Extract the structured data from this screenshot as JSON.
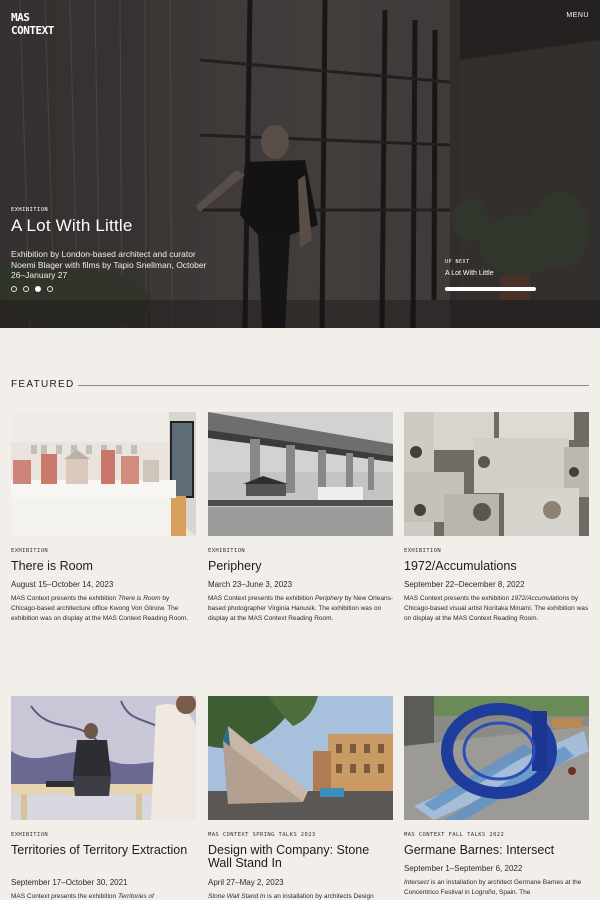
{
  "brand": {
    "logo_line1": "MAS",
    "logo_line2": "CONTEXT"
  },
  "nav": {
    "menu_label": "MENU"
  },
  "hero": {
    "eyebrow": "EXHIBITION",
    "title": "A Lot With Little",
    "description": "Exhibition by London-based architect and curator Noemi Blager with films by Tapio Snellman, October 26–January 27",
    "slides": 4,
    "active_slide": 3,
    "up_next_label": "UP NEXT",
    "up_next_title": "A Lot With Little"
  },
  "featured": {
    "heading": "FEATURED",
    "cards": [
      {
        "eyebrow": "EXHIBITION",
        "title": "There is Room",
        "dates": "August 15–October 14, 2023",
        "desc_pre": "MAS Context presents the exhibition ",
        "desc_em": "There is Room",
        "desc_post": " by Chicago-based architecture office Kwong Von Glinow. The exhibition was on display at the MAS Context Reading Room."
      },
      {
        "eyebrow": "EXHIBITION",
        "title": "Periphery",
        "dates": "March 23–June 3, 2023",
        "desc_pre": "MAS Context presents the exhibition ",
        "desc_em": "Periphery",
        "desc_post": " by New Orleans-based photographer Virginia Hanusik. The exhibition was on display at the MAS Context Reading Room."
      },
      {
        "eyebrow": "EXHIBITION",
        "title": "1972/Accumulations",
        "dates": "September 22–December 8, 2022",
        "desc_pre": "MAS Context presents the exhibition ",
        "desc_em": "1972/Accumulations",
        "desc_post": " by Chicago-based visual artist Noritaka Minami. The exhibition was on display at the MAS Context Reading Room."
      },
      {
        "eyebrow": "EXHIBITION",
        "title": "Territories of Territory Extraction",
        "dates": "September 17–October 30, 2021",
        "desc_pre": "MAS Context presents the exhibition ",
        "desc_em": "Territories of",
        "desc_post": ""
      },
      {
        "eyebrow": "MAS CONTEXT SPRING TALKS 2023",
        "title": "Design with Company: Stone Wall Stand In",
        "dates": "April 27–May 2, 2023",
        "desc_pre": "",
        "desc_em": "Stone Wall Stand In",
        "desc_post": " is an installation by architects Design"
      },
      {
        "eyebrow": "MAS CONTEXT FALL TALKS 2022",
        "title": "Germane Barnes: Intersect",
        "dates": "September 1–September 6, 2022",
        "desc_pre": "",
        "desc_em": "Intersect",
        "desc_post": " is an installation by architect Germane Barnes at the Concentrico Festival in Logroño, Spain. The"
      }
    ]
  }
}
